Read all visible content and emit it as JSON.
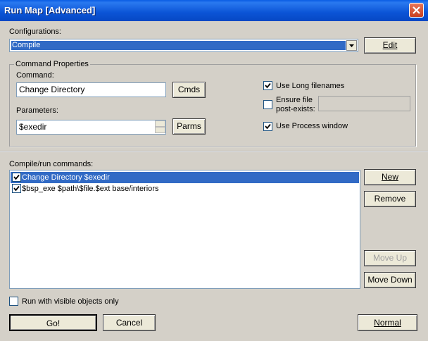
{
  "window": {
    "title": "Run Map [Advanced]"
  },
  "configurations": {
    "label": "Configurations:",
    "selected": "Compile",
    "edit_button": "Edit"
  },
  "command_properties": {
    "group_title": "Command Properties",
    "command_label": "Command:",
    "command_value": "Change Directory",
    "cmds_button": "Cmds",
    "parameters_label": "Parameters:",
    "parameters_value": "$exedir",
    "parms_button": "Parms",
    "use_long_filenames": {
      "label": "Use Long filenames",
      "checked": true
    },
    "ensure_file": {
      "label_line1": "Ensure file",
      "label_line2": "post-exists:",
      "checked": false,
      "value": ""
    },
    "use_process_window": {
      "label": "Use Process window",
      "checked": true
    }
  },
  "commands": {
    "label": "Compile/run commands:",
    "items": [
      {
        "text": "Change Directory $exedir",
        "checked": true,
        "selected": true
      },
      {
        "text": "$bsp_exe $path\\$file.$ext base/interiors",
        "checked": true,
        "selected": false
      }
    ],
    "new_button": "New",
    "remove_button": "Remove",
    "move_up_button": "Move Up",
    "move_down_button": "Move Down"
  },
  "visible_only": {
    "label": "Run with visible objects only",
    "checked": false
  },
  "footer": {
    "go_button": "Go!",
    "cancel_button": "Cancel",
    "normal_button": "Normal"
  },
  "colors": {
    "title_bar": "#0b54d6",
    "selection": "#316ac5",
    "dialog_bg": "#d4d0c8"
  }
}
